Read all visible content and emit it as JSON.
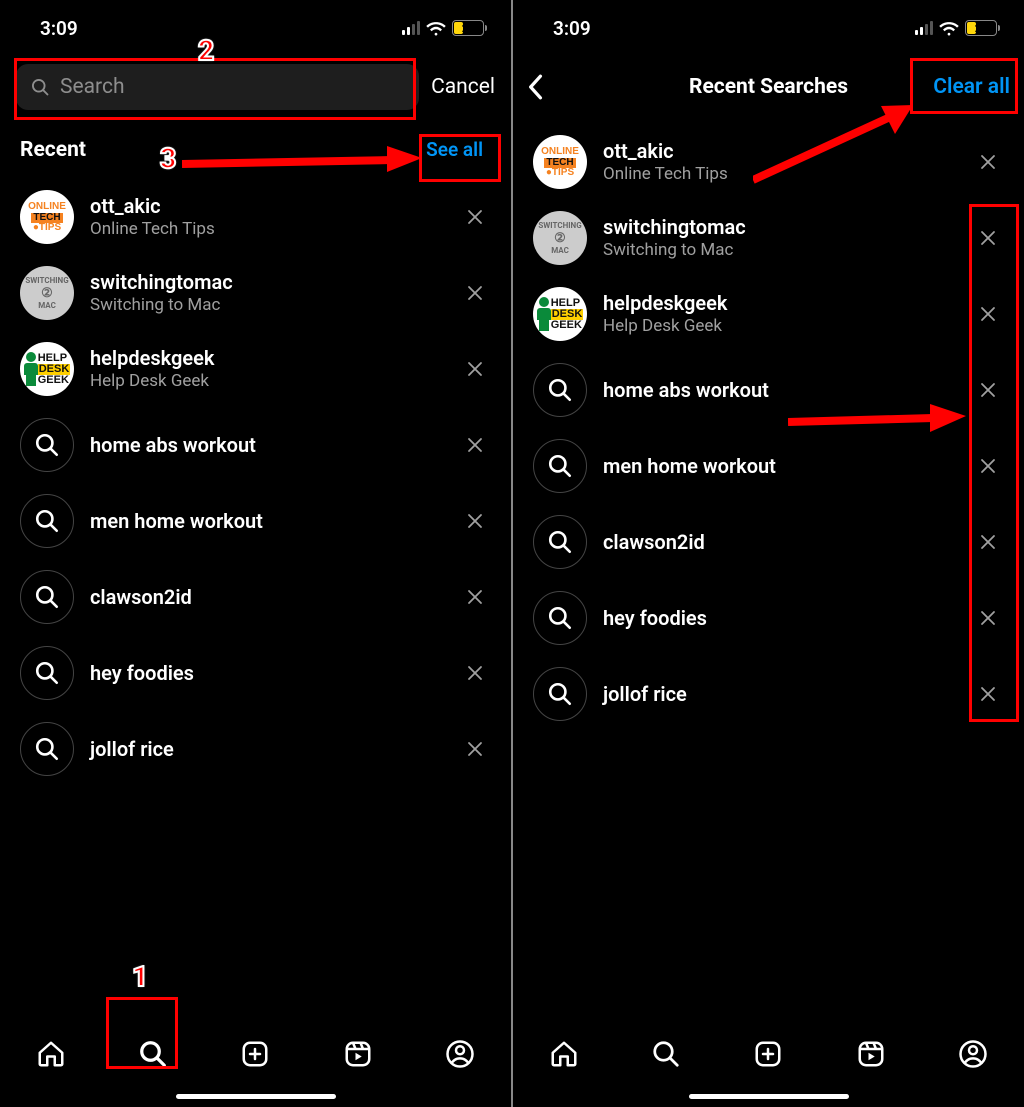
{
  "status": {
    "time": "3:09",
    "battery_pct": "25"
  },
  "left": {
    "search_placeholder": "Search",
    "cancel": "Cancel",
    "section_title": "Recent",
    "see_all": "See all",
    "items": [
      {
        "type": "user",
        "title": "ott_akic",
        "sub": "Online Tech Tips"
      },
      {
        "type": "user",
        "title": "switchingtomac",
        "sub": "Switching to Mac"
      },
      {
        "type": "user",
        "title": "helpdeskgeek",
        "sub": "Help Desk Geek"
      },
      {
        "type": "query",
        "title": "home abs workout"
      },
      {
        "type": "query",
        "title": "men home workout"
      },
      {
        "type": "query",
        "title": "clawson2id"
      },
      {
        "type": "query",
        "title": "hey foodies"
      },
      {
        "type": "query",
        "title": "jollof rice"
      }
    ]
  },
  "right": {
    "page_title": "Recent Searches",
    "clear_all": "Clear all",
    "items": [
      {
        "type": "user",
        "title": "ott_akic",
        "sub": "Online Tech Tips"
      },
      {
        "type": "user",
        "title": "switchingtomac",
        "sub": "Switching to Mac"
      },
      {
        "type": "user",
        "title": "helpdeskgeek",
        "sub": "Help Desk Geek"
      },
      {
        "type": "query",
        "title": "home abs workout"
      },
      {
        "type": "query",
        "title": "men home workout"
      },
      {
        "type": "query",
        "title": "clawson2id"
      },
      {
        "type": "query",
        "title": "hey foodies"
      },
      {
        "type": "query",
        "title": "jollof rice"
      }
    ]
  },
  "annotations": {
    "n1": "1",
    "n2": "2",
    "n3": "3"
  },
  "colors": {
    "accent": "#0095f6",
    "battery": "#ffd60a",
    "anno": "#ff0000"
  }
}
